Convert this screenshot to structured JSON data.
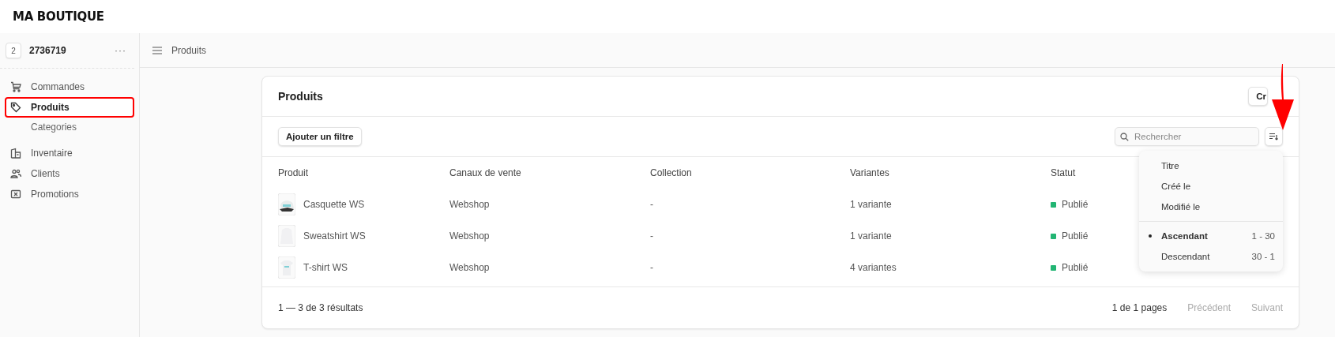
{
  "brand": "MA BOUTIQUE",
  "store": {
    "badge": "2",
    "name": "2736719",
    "menu": "···"
  },
  "sidebar": {
    "items": [
      {
        "label": "Commandes",
        "selected": false,
        "highlighted": false
      },
      {
        "label": "Produits",
        "selected": true,
        "highlighted": true,
        "children": [
          {
            "label": "Categories",
            "selected": false
          }
        ]
      },
      {
        "label": "Inventaire",
        "selected": false,
        "highlighted": false
      },
      {
        "label": "Clients",
        "selected": false,
        "highlighted": false
      },
      {
        "label": "Promotions",
        "selected": false,
        "highlighted": false
      }
    ]
  },
  "topbar": {
    "title": "Produits"
  },
  "card": {
    "title": "Produits",
    "create_button": "Cr",
    "filter_button": "Ajouter un filtre",
    "search": {
      "placeholder": "Rechercher"
    },
    "table": {
      "columns": [
        "Produit",
        "Canaux de vente",
        "Collection",
        "Variantes",
        "Statut"
      ],
      "rows": [
        {
          "product": "Casquette WS",
          "channels": "Webshop",
          "collection": "-",
          "variants": "1 variante",
          "status": "Publié",
          "color": "#22b573"
        },
        {
          "product": "Sweatshirt WS",
          "channels": "Webshop",
          "collection": "-",
          "variants": "1 variante",
          "status": "Publié",
          "color": "#22b573"
        },
        {
          "product": "T-shirt WS",
          "channels": "Webshop",
          "collection": "-",
          "variants": "4 variantes",
          "status": "Publié",
          "color": "#22b573"
        }
      ]
    },
    "footer": {
      "count": "1 — 3 de 3 résultats",
      "pages": "1 de 1 pages",
      "previous": "Précédent",
      "next": "Suivant",
      "previous_disabled": true,
      "next_disabled": true
    }
  },
  "sort_menu": {
    "open": true,
    "fields": [
      {
        "label": "Titre",
        "selected": false
      },
      {
        "label": "Créé le",
        "selected": false
      },
      {
        "label": "Modifié le",
        "selected": false
      }
    ],
    "orders": [
      {
        "label": "Ascendant",
        "range": "1 - 30",
        "selected": true
      },
      {
        "label": "Descendant",
        "range": "30 - 1",
        "selected": false
      }
    ]
  },
  "annotation_arrow": true
}
